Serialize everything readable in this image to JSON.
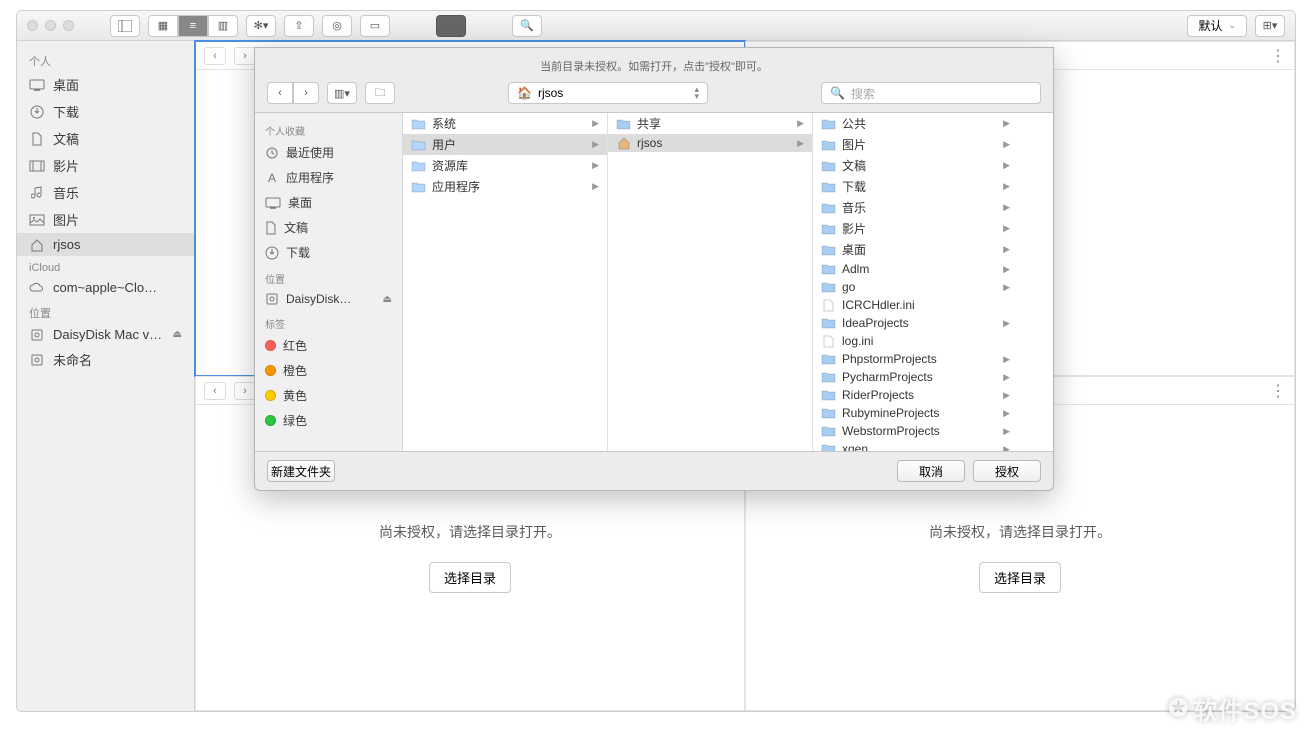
{
  "toolbar": {
    "view_mode_label": "默认"
  },
  "sidebar": {
    "sections": [
      {
        "header": "个人",
        "items": [
          {
            "label": "桌面",
            "icon": "desktop-icon"
          },
          {
            "label": "下载",
            "icon": "download-icon"
          },
          {
            "label": "文稿",
            "icon": "document-icon"
          },
          {
            "label": "影片",
            "icon": "movie-icon"
          },
          {
            "label": "音乐",
            "icon": "music-icon"
          },
          {
            "label": "图片",
            "icon": "picture-icon"
          },
          {
            "label": "rjsos",
            "icon": "home-icon",
            "selected": true
          }
        ]
      },
      {
        "header": "iCloud",
        "items": [
          {
            "label": "com~apple~Clo…",
            "icon": "cloud-icon"
          }
        ]
      },
      {
        "header": "位置",
        "items": [
          {
            "label": "DaisyDisk Mac v…",
            "icon": "disk-icon",
            "eject": true
          },
          {
            "label": "未命名",
            "icon": "disk-icon"
          }
        ]
      }
    ]
  },
  "panes": {
    "unauthorized_msg": "尚未授权，请选择目录打开。",
    "partial_msg": "录打开。",
    "choose_btn": "选择目录"
  },
  "dialog": {
    "title": "当前目录未授权。如需打开，点击\"授权\"即可。",
    "path_label": "rjsos",
    "search_placeholder": "搜索",
    "new_folder": "新建文件夹",
    "cancel": "取消",
    "authorize": "授权",
    "sidebar": {
      "fav_header": "个人收藏",
      "fav_items": [
        {
          "label": "最近使用",
          "icon": "recent-icon"
        },
        {
          "label": "应用程序",
          "icon": "apps-icon"
        },
        {
          "label": "桌面",
          "icon": "desktop-icon"
        },
        {
          "label": "文稿",
          "icon": "document-icon"
        },
        {
          "label": "下载",
          "icon": "download-icon"
        }
      ],
      "loc_header": "位置",
      "loc_items": [
        {
          "label": "DaisyDisk…",
          "icon": "disk-icon",
          "eject": true
        }
      ],
      "tag_header": "标签",
      "tags": [
        {
          "label": "红色",
          "color": "#ff5f57"
        },
        {
          "label": "橙色",
          "color": "#ff9500"
        },
        {
          "label": "黄色",
          "color": "#ffcc00"
        },
        {
          "label": "绿色",
          "color": "#28c840"
        }
      ]
    },
    "columns": [
      [
        {
          "label": "系统",
          "type": "folder",
          "color": "#b3d6ff"
        },
        {
          "label": "用户",
          "type": "folder",
          "color": "#b3d6ff",
          "selected": true
        },
        {
          "label": "资源库",
          "type": "folder",
          "color": "#b3d6ff"
        },
        {
          "label": "应用程序",
          "type": "folder",
          "color": "#b3d6ff"
        }
      ],
      [
        {
          "label": "共享",
          "type": "folder",
          "color": "#a9cef4"
        },
        {
          "label": "rjsos",
          "type": "home",
          "color": "#e8b87a",
          "selected": true
        }
      ],
      [
        {
          "label": "公共",
          "type": "folder",
          "color": "#a9cef4"
        },
        {
          "label": "图片",
          "type": "folder",
          "color": "#a9cef4"
        },
        {
          "label": "文稿",
          "type": "folder",
          "color": "#a9cef4"
        },
        {
          "label": "下载",
          "type": "folder",
          "color": "#a9cef4"
        },
        {
          "label": "音乐",
          "type": "folder",
          "color": "#a9cef4"
        },
        {
          "label": "影片",
          "type": "folder",
          "color": "#a9cef4"
        },
        {
          "label": "桌面",
          "type": "folder",
          "color": "#a9cef4"
        },
        {
          "label": "Adlm",
          "type": "folder",
          "color": "#a9cef4"
        },
        {
          "label": "go",
          "type": "folder",
          "color": "#a9cef4"
        },
        {
          "label": "ICRCHdler.ini",
          "type": "file"
        },
        {
          "label": "IdeaProjects",
          "type": "folder",
          "color": "#a9cef4"
        },
        {
          "label": "log.ini",
          "type": "file"
        },
        {
          "label": "PhpstormProjects",
          "type": "folder",
          "color": "#a9cef4"
        },
        {
          "label": "PycharmProjects",
          "type": "folder",
          "color": "#a9cef4"
        },
        {
          "label": "RiderProjects",
          "type": "folder",
          "color": "#a9cef4"
        },
        {
          "label": "RubymineProjects",
          "type": "folder",
          "color": "#a9cef4"
        },
        {
          "label": "WebstormProjects",
          "type": "folder",
          "color": "#a9cef4"
        },
        {
          "label": "xgen",
          "type": "folder",
          "color": "#a9cef4"
        }
      ]
    ]
  },
  "watermark": "软件SOS"
}
